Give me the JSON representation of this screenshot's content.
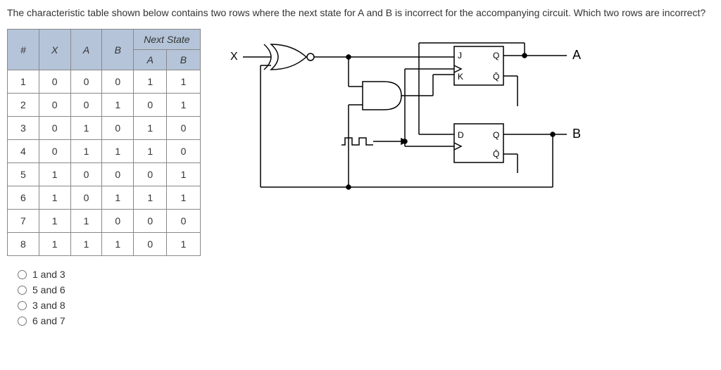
{
  "question": "The characteristic table shown below contains two rows where the next state for A and B is incorrect for the accompanying circuit. Which two rows are incorrect?",
  "table": {
    "headers": {
      "row1": [
        "#",
        "X",
        "A",
        "B"
      ],
      "nextState": "Next State",
      "sub": [
        "A",
        "B"
      ]
    },
    "rows": [
      {
        "n": "1",
        "x": "0",
        "a": "0",
        "b": "0",
        "na": "1",
        "nb": "1"
      },
      {
        "n": "2",
        "x": "0",
        "a": "0",
        "b": "1",
        "na": "0",
        "nb": "1"
      },
      {
        "n": "3",
        "x": "0",
        "a": "1",
        "b": "0",
        "na": "1",
        "nb": "0"
      },
      {
        "n": "4",
        "x": "0",
        "a": "1",
        "b": "1",
        "na": "1",
        "nb": "0"
      },
      {
        "n": "5",
        "x": "1",
        "a": "0",
        "b": "0",
        "na": "0",
        "nb": "1"
      },
      {
        "n": "6",
        "x": "1",
        "a": "0",
        "b": "1",
        "na": "1",
        "nb": "1"
      },
      {
        "n": "7",
        "x": "1",
        "a": "1",
        "b": "0",
        "na": "0",
        "nb": "0"
      },
      {
        "n": "8",
        "x": "1",
        "a": "1",
        "b": "1",
        "na": "0",
        "nb": "1"
      }
    ]
  },
  "options": [
    {
      "label": "1 and 3"
    },
    {
      "label": "5 and 6"
    },
    {
      "label": "3 and 8"
    },
    {
      "label": "6 and 7"
    }
  ],
  "circuit": {
    "input": "X",
    "outA": "A",
    "outB": "B",
    "ffA": {
      "J": "J",
      "K": "K",
      "Q": "Q",
      "Qb": "Q̄"
    },
    "ffB": {
      "D": "D",
      "Q": "Q",
      "Qb": "Q̄"
    }
  },
  "chart_data": {
    "type": "table",
    "title": "Characteristic table",
    "columns": [
      "#",
      "X",
      "A",
      "B",
      "Next A",
      "Next B"
    ],
    "rows": [
      [
        1,
        0,
        0,
        0,
        1,
        1
      ],
      [
        2,
        0,
        0,
        1,
        0,
        1
      ],
      [
        3,
        0,
        1,
        0,
        1,
        0
      ],
      [
        4,
        0,
        1,
        1,
        1,
        0
      ],
      [
        5,
        1,
        0,
        0,
        0,
        1
      ],
      [
        6,
        1,
        0,
        1,
        1,
        1
      ],
      [
        7,
        1,
        1,
        0,
        0,
        0
      ],
      [
        8,
        1,
        1,
        1,
        0,
        1
      ]
    ]
  }
}
